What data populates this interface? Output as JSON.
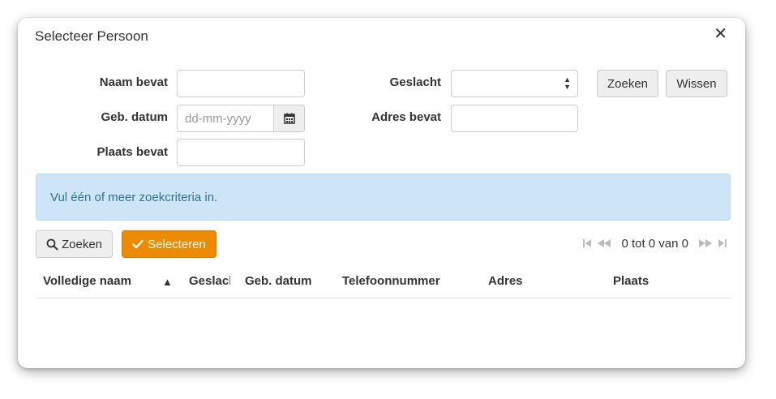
{
  "dialog": {
    "title": "Selecteer Persoon"
  },
  "form": {
    "name_label": "Naam bevat",
    "name_value": "",
    "birthdate_label": "Geb. datum",
    "birthdate_placeholder": "dd-mm-yyyy",
    "place_label": "Plaats bevat",
    "place_value": "",
    "gender_label": "Geslacht",
    "gender_value": "",
    "address_label": "Adres bevat",
    "address_value": "",
    "search_label": "Zoeken",
    "clear_label": "Wissen"
  },
  "alert": {
    "message": "Vul één of meer zoekcriteria in."
  },
  "toolbar": {
    "search_label": "Zoeken",
    "select_label": "Selecteren"
  },
  "pager": {
    "text": "0 tot 0 van 0"
  },
  "table": {
    "columns": [
      "Volledige naam",
      "Geslacht",
      "Geb. datum",
      "Telefoonnummer",
      "Adres",
      "Plaats"
    ],
    "sort_indicator": "▲",
    "rows": []
  },
  "icons": {
    "close": "close-icon",
    "calendar": "calendar-icon",
    "search": "search-icon",
    "check": "check-icon"
  },
  "colors": {
    "accent": "#ec8a00",
    "alert_bg": "#cde5f6",
    "alert_text": "#31708f"
  }
}
